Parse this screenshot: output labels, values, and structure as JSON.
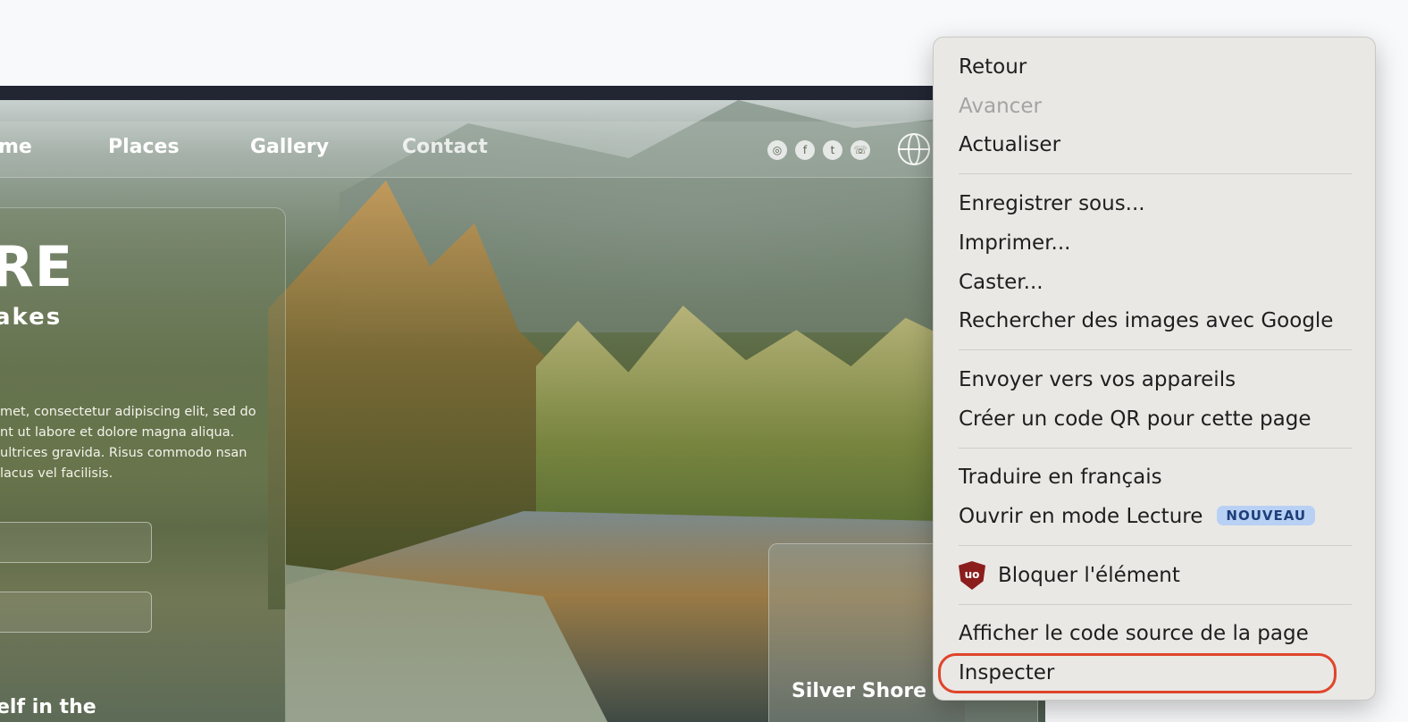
{
  "website": {
    "nav": [
      "me",
      "Places",
      "Gallery",
      "Contact"
    ],
    "social_icons": [
      "instagram-icon",
      "facebook-icon",
      "twitter-icon",
      "whatsapp-icon"
    ],
    "hero_title": "RE",
    "hero_subtitle": "akes",
    "hero_text": "met, consectetur adipiscing elit, sed do nt ut labore et dolore magna aliqua. ultrices gravida. Risus commodo nsan lacus vel facilisis.",
    "hero_footer": "elf in the",
    "card2_title": "Silver Shore"
  },
  "context_menu": {
    "items": [
      {
        "label": "Retour",
        "enabled": true
      },
      {
        "label": "Avancer",
        "enabled": false
      },
      {
        "label": "Actualiser",
        "enabled": true
      },
      {
        "label": "Enregistrer sous...",
        "enabled": true
      },
      {
        "label": "Imprimer...",
        "enabled": true
      },
      {
        "label": "Caster...",
        "enabled": true
      },
      {
        "label": "Rechercher des images avec Google",
        "enabled": true
      },
      {
        "label": "Envoyer vers vos appareils",
        "enabled": true
      },
      {
        "label": "Créer un code QR pour cette page",
        "enabled": true
      },
      {
        "label": "Traduire en français",
        "enabled": true
      },
      {
        "label": "Ouvrir en mode Lecture",
        "enabled": true,
        "badge": "NOUVEAU"
      },
      {
        "label": "Bloquer l'élément",
        "enabled": true,
        "icon": "ublock-origin-icon",
        "icon_text": "uo"
      },
      {
        "label": "Afficher le code source de la page",
        "enabled": true
      },
      {
        "label": "Inspecter",
        "enabled": true,
        "highlighted": true
      }
    ],
    "highlight_color": "#e0452b"
  }
}
